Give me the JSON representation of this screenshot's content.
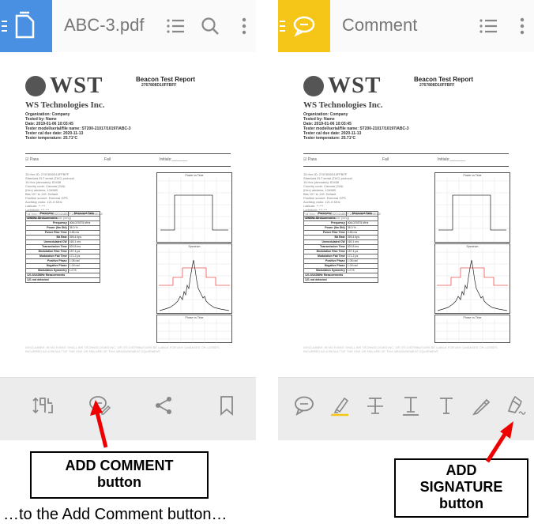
{
  "left": {
    "title": "ABC-3.pdf",
    "accent": "#4a90e2"
  },
  "right": {
    "title": "Comment",
    "accent": "#f5c518"
  },
  "report": {
    "brand": "WST",
    "brand_sub": "WS Technologies Inc.",
    "title": "Beacon Test Report",
    "id": "2767808D10FFBFF",
    "meta": [
      "Organization: Company",
      "Tested by: Name",
      "Date: 2019-01-06 10:03:45",
      "Tester model/serial/file name: ST200-21017/10197/ABC-3",
      "Tester cal due date: 2020-11-13",
      "Tester temperature: 25.71°C"
    ],
    "pass": "☑ Pass",
    "fail": "Fail",
    "initials": "Initials:_______",
    "info_lines": [
      "15 Hex ID: 2767808D10FFBFF",
      "Standard ELT serial (TAC) protocol",
      "15 Hex (decoded): 81636",
      "Country code: Canada (316)",
      "(Hex) address: 12A580",
      "Bits 107 to 110: Default",
      "Position source: External GPS",
      "Auxiliary radio: 121.5 MHz",
      "Latitude: **.***",
      "Longitude: ***.***",
      "Full Hex: FFFE2F9D32D4A8B7F25F8E0BFF2ED0EA3",
      "Burst mode: Normal mode (long)"
    ],
    "table_header": [
      "Parameter",
      "Measured Data"
    ],
    "table_rows": [
      [
        "406MHz Measurements",
        ""
      ],
      [
        "Frequency",
        "406.037875 MHz"
      ],
      [
        "Power (Ilm Dbl)",
        "35.0 %"
      ],
      [
        "Power Rise Time",
        "0.86 ms"
      ],
      [
        "Bit Rate",
        "399.4 bps"
      ],
      [
        "Unmodulated CW",
        "160.1 ms"
      ],
      [
        "Transmission Time",
        "520.8 ms"
      ],
      [
        "Modulation Rise Time",
        "157.4 µs"
      ],
      [
        "Modulation Fall Time",
        "171.2 µs"
      ],
      [
        "Positive Phase",
        "1.08 rad"
      ],
      [
        "Negative Phase",
        "1.09 rad"
      ],
      [
        "Modulation Symmetry",
        "1.0 %"
      ],
      [
        "121.5/243MHz Measurements",
        ""
      ],
      [
        "121 not detected",
        ""
      ]
    ],
    "graph_titles": [
      "Power vs Time",
      "Spectrum",
      "Phase vs Time"
    ],
    "disclaimer": "DISCLAIMER: IN NO EVENT SHALL WS TECHNOLOGIES INC. OR ITS DISTRIBUTORS BE LIABLE FOR ANY DAMAGES OR LOSSES INCURRED AS A RESULT OF THE USE OR FAILURE OF THIS MEASUREMENT EQUIPMENT."
  },
  "callouts": {
    "add_comment": [
      "ADD COMMENT",
      "button"
    ],
    "add_signature": [
      "ADD",
      "SIGNATURE",
      "button"
    ]
  },
  "caption": "…to the Add Comment button…",
  "icons": {
    "left_toolbar": [
      "list-icon",
      "search-icon",
      "more-vert-icon"
    ],
    "left_bottom": [
      "fit-page-icon",
      "add-comment-icon",
      "share-icon",
      "bookmark-icon"
    ],
    "right_toolbar": [
      "list-icon",
      "more-vert-icon"
    ],
    "right_bottom": [
      "comment-icon",
      "highlight-icon",
      "strikethrough-icon",
      "underline-icon",
      "text-icon",
      "pencil-icon",
      "signature-icon"
    ]
  }
}
